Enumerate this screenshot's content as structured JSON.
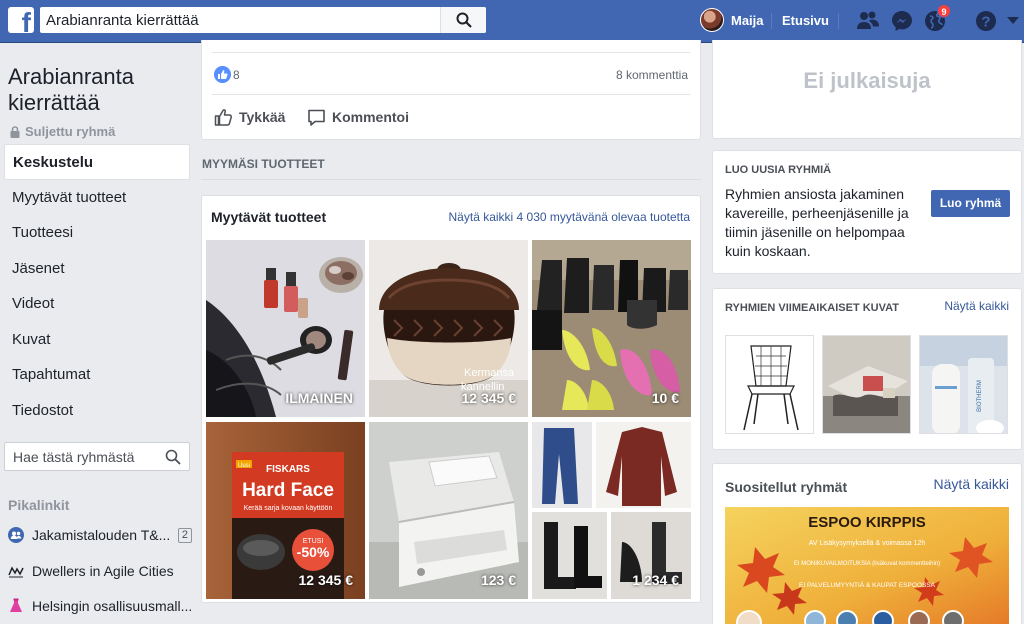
{
  "topbar": {
    "search_value": "Arabianranta kierrättää",
    "profile_name": "Maija",
    "home_label": "Etusivu",
    "notifications_count": "9"
  },
  "sidebar": {
    "group_name": "Arabianranta kierrättää",
    "group_status": "Suljettu ryhmä",
    "items": [
      {
        "label": "Keskustelu",
        "active": true
      },
      {
        "label": "Myytävät tuotteet"
      },
      {
        "label": "Tuotteesi"
      },
      {
        "label": "Jäsenet"
      },
      {
        "label": "Videot"
      },
      {
        "label": "Kuvat"
      },
      {
        "label": "Tapahtumat"
      },
      {
        "label": "Tiedostot"
      }
    ],
    "search_placeholder": "Hae tästä ryhmästä",
    "shortcuts_title": "Pikalinkit",
    "shortcuts": [
      {
        "label": "Jakamistalouden T&...",
        "count": "2"
      },
      {
        "label": "Dwellers in Agile Cities"
      },
      {
        "label": "Helsingin osallisuusmall..."
      }
    ]
  },
  "post": {
    "likes": "8",
    "comments": "8 kommenttia",
    "like_label": "Tykkää",
    "comment_label": "Kommentoi"
  },
  "section_label": "MYYMÄSI TUOTTEET",
  "products": {
    "title": "Myytävät tuotteet",
    "see_all": "Näytä kaikki 4 030 myytävänä olevaa tuotetta",
    "items": [
      {
        "price": "ILMAINEN",
        "subject": "cosmetics"
      },
      {
        "price": "12 345 €",
        "subject": "ceramic-pot"
      },
      {
        "price": "10 €",
        "subject": "shoes"
      },
      {
        "price": "12 345 €",
        "subject": "fiskars-book"
      },
      {
        "price": "123 €",
        "subject": "printer"
      },
      {
        "price": "1 234 €",
        "subject": "clothes"
      }
    ],
    "pot_caption_1": "Kermansa",
    "pot_caption_2": "kannellin",
    "book_brand": "FISKARS",
    "book_title": "Hard Face",
    "book_subtitle": "Kerää sarja kovaan käyttöön",
    "book_badge": "Uusi",
    "book_discount_top": "ETUSI",
    "book_discount": "-50%"
  },
  "right": {
    "no_posts": "Ei julkaisuja",
    "create_title": "LUO UUSIA RYHMIÄ",
    "create_text": "Ryhmien ansiosta jakaminen kavereille, perheenjäsenille ja tiimin jäsenille on helpompaa kuin koskaan.",
    "create_button": "Luo ryhmä",
    "photos_title": "RYHMIEN VIIMEAIKAISET KUVAT",
    "photos_link": "Näytä kaikki",
    "recommended_title": "Suositellut ryhmät",
    "recommended_link": "Näytä kaikki",
    "banner_title": "ESPOO KIRPPIS",
    "banner_line1": "AV Lisäkysymyksellä & voimassa 12h",
    "banner_line2": "EI MONIKUVAILMOITUKSIA (lisäkuvat kommentteihin)",
    "banner_line3": "EI PALVELUMYYNTIÄ & KAUPAT ESPOOSSA",
    "thumb_brand": "BIOTHERM"
  },
  "colors": {
    "brand": "#4267b2",
    "link": "#365899",
    "badge": "#fa3e3e"
  }
}
